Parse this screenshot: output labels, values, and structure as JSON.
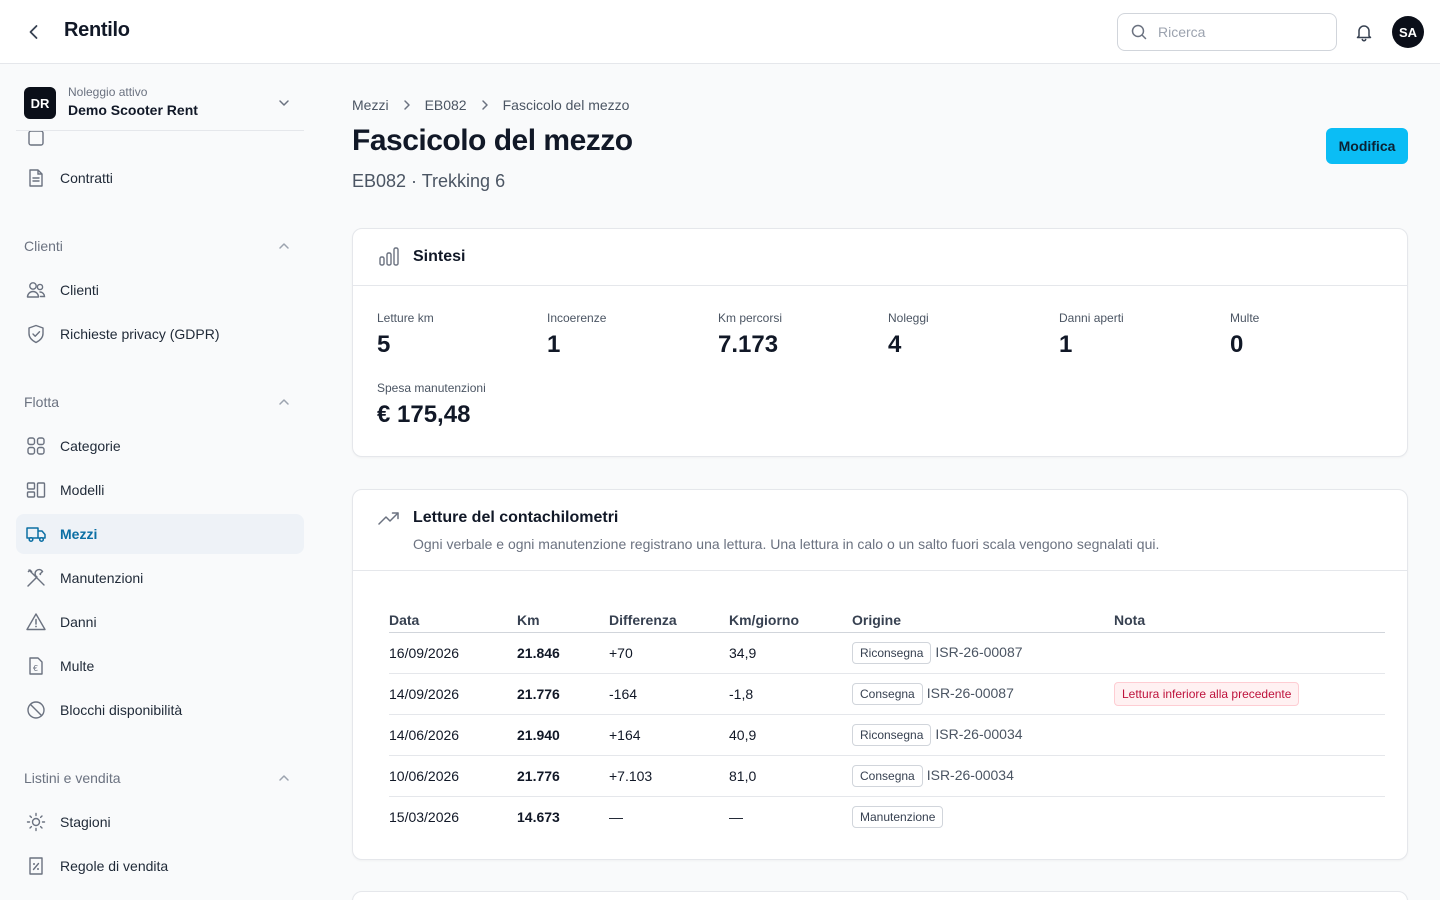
{
  "app": {
    "title": "Rentilo"
  },
  "search": {
    "placeholder": "Ricerca"
  },
  "user": {
    "initials": "SA"
  },
  "rental": {
    "badge": "DR",
    "caption": "Noleggio attivo",
    "name": "Demo Scooter Rent"
  },
  "sidebar": {
    "contracts_label": "Contratti",
    "sections": [
      {
        "label": "Clienti",
        "items": [
          {
            "label": "Clienti",
            "icon": "users-icon"
          },
          {
            "label": "Richieste privacy (GDPR)",
            "icon": "shield-icon"
          }
        ]
      },
      {
        "label": "Flotta",
        "items": [
          {
            "label": "Categorie",
            "icon": "grid-icon"
          },
          {
            "label": "Modelli",
            "icon": "layout-icon"
          },
          {
            "label": "Mezzi",
            "icon": "truck-icon",
            "active": true
          },
          {
            "label": "Manutenzioni",
            "icon": "wrench-icon"
          },
          {
            "label": "Danni",
            "icon": "warning-icon"
          },
          {
            "label": "Multe",
            "icon": "euro-doc-icon"
          },
          {
            "label": "Blocchi disponibilità",
            "icon": "ban-icon"
          }
        ]
      },
      {
        "label": "Listini e vendita",
        "items": [
          {
            "label": "Stagioni",
            "icon": "sun-icon"
          },
          {
            "label": "Regole di vendita",
            "icon": "percent-doc-icon"
          }
        ]
      }
    ]
  },
  "breadcrumb": [
    "Mezzi",
    "EB082",
    "Fascicolo del mezzo"
  ],
  "page": {
    "title": "Fascicolo del mezzo",
    "subtitle": "EB082 · Trekking 6",
    "edit_label": "Modifica"
  },
  "summary": {
    "title": "Sintesi",
    "stats": [
      {
        "label": "Letture km",
        "value": "5"
      },
      {
        "label": "Incoerenze",
        "value": "1"
      },
      {
        "label": "Km percorsi",
        "value": "7.173"
      },
      {
        "label": "Noleggi",
        "value": "4"
      },
      {
        "label": "Danni aperti",
        "value": "1"
      },
      {
        "label": "Multe",
        "value": "0"
      },
      {
        "label": "Spesa manutenzioni",
        "value": "€ 175,48"
      }
    ]
  },
  "readings": {
    "title": "Letture del contachilometri",
    "description": "Ogni verbale e ogni manutenzione registrano una lettura. Una lettura in calo o un salto fuori scala vengono segnalati qui.",
    "columns": [
      "Data",
      "Km",
      "Differenza",
      "Km/giorno",
      "Origine",
      "Nota"
    ],
    "rows": [
      {
        "date": "16/09/2026",
        "km": "21.846",
        "diff": "+70",
        "kmday": "34,9",
        "origin": "Riconsegna",
        "ref": "ISR-26-00087",
        "note": ""
      },
      {
        "date": "14/09/2026",
        "km": "21.776",
        "diff": "-164",
        "kmday": "-1,8",
        "origin": "Consegna",
        "ref": "ISR-26-00087",
        "note": "Lettura inferiore alla precedente"
      },
      {
        "date": "14/06/2026",
        "km": "21.940",
        "diff": "+164",
        "kmday": "40,9",
        "origin": "Riconsegna",
        "ref": "ISR-26-00034",
        "note": ""
      },
      {
        "date": "10/06/2026",
        "km": "21.776",
        "diff": "+7.103",
        "kmday": "81,0",
        "origin": "Consegna",
        "ref": "ISR-26-00034",
        "note": ""
      },
      {
        "date": "15/03/2026",
        "km": "14.673",
        "diff": "—",
        "kmday": "—",
        "origin": "Manutenzione",
        "ref": "",
        "note": ""
      }
    ]
  },
  "colors": {
    "accent": "#0bbdf5",
    "active_text": "#0b6fa4",
    "warning": "#be123c"
  }
}
